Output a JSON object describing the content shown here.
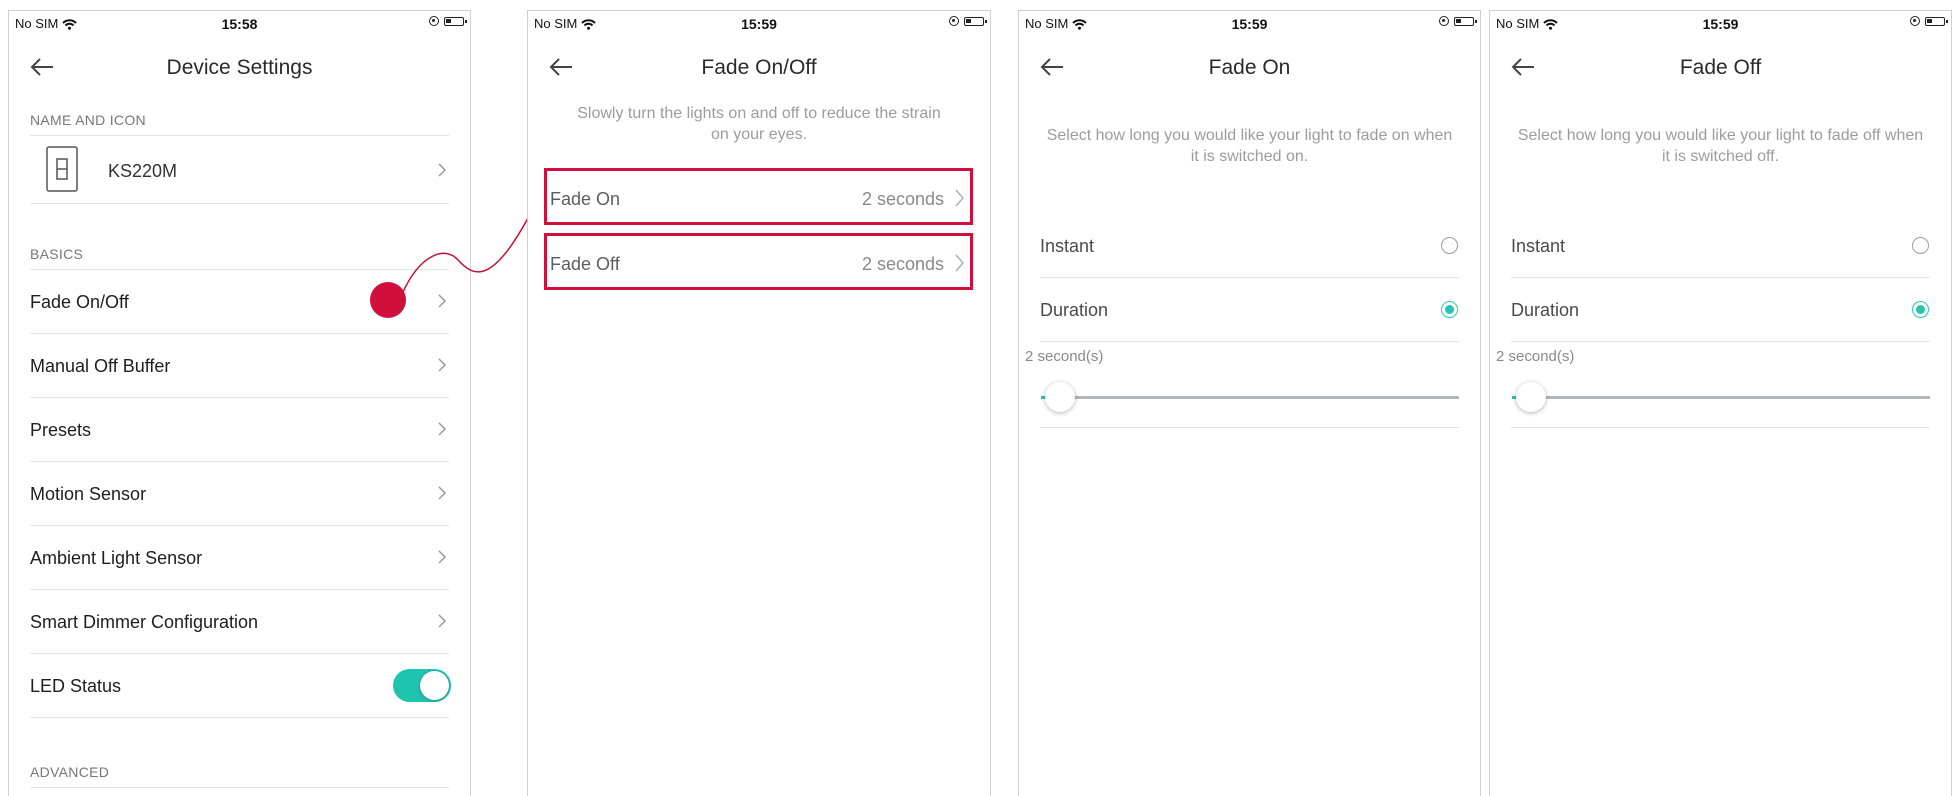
{
  "screens": [
    {
      "status": {
        "carrier": "No SIM",
        "time": "15:58"
      },
      "title": "Device Settings",
      "sections": {
        "name_icon": "NAME AND ICON",
        "basics": "BASICS",
        "advanced": "ADVANCED"
      },
      "device": {
        "name": "KS220M",
        "icon": "light-switch-icon"
      },
      "rows": [
        {
          "label": "Fade On/Off"
        },
        {
          "label": "Manual Off Buffer"
        },
        {
          "label": "Presets"
        },
        {
          "label": "Motion Sensor"
        },
        {
          "label": "Ambient Light Sensor"
        },
        {
          "label": "Smart Dimmer Configuration"
        }
      ],
      "led": {
        "label": "LED Status",
        "on": true
      }
    },
    {
      "status": {
        "carrier": "No SIM",
        "time": "15:59"
      },
      "title": "Fade On/Off",
      "description": "Slowly turn the lights on and off to reduce the strain on your eyes.",
      "items": [
        {
          "label": "Fade On",
          "value": "2 seconds"
        },
        {
          "label": "Fade Off",
          "value": "2 seconds"
        }
      ]
    },
    {
      "status": {
        "carrier": "No SIM",
        "time": "15:59"
      },
      "title": "Fade On",
      "description": "Select how long you would like your light to fade on when it is switched on.",
      "options": [
        {
          "label": "Instant",
          "selected": false
        },
        {
          "label": "Duration",
          "selected": true
        }
      ],
      "slider_label": "2 second(s)",
      "slider_fraction": 0.04
    },
    {
      "status": {
        "carrier": "No SIM",
        "time": "15:59"
      },
      "title": "Fade Off",
      "description": "Select how long you would like your light to fade off when it is switched off.",
      "options": [
        {
          "label": "Instant",
          "selected": false
        },
        {
          "label": "Duration",
          "selected": true
        }
      ],
      "slider_label": "2 second(s)",
      "slider_fraction": 0.04
    }
  ],
  "colors": {
    "accent": "#25c4b0",
    "highlight": "#d0103a"
  }
}
